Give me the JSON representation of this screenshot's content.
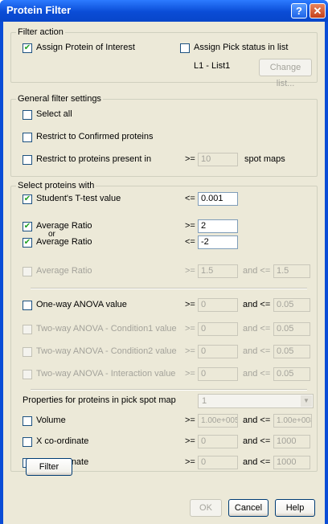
{
  "window": {
    "title": "Protein Filter",
    "help_glyph": "?",
    "close_glyph": "✕"
  },
  "check_glyph": "✔",
  "filter_action": {
    "legend": "Filter action",
    "assign_protein": {
      "label": "Assign Protein of Interest",
      "checked": true
    },
    "assign_pick": {
      "label": "Assign Pick status in list",
      "checked": false
    },
    "list_name": "L1 - List1",
    "change_list": "Change list..."
  },
  "general": {
    "legend": "General filter settings",
    "select_all": {
      "label": "Select all",
      "checked": false
    },
    "confirmed": {
      "label": "Restrict to Confirmed proteins",
      "checked": false
    },
    "present_in": {
      "label": "Restrict to proteins present in",
      "checked": false,
      "op": ">=",
      "value": "10",
      "unit": "spot maps"
    }
  },
  "select": {
    "legend": "Select proteins with",
    "ttest": {
      "label": "Student's T-test value",
      "checked": true,
      "op": "<=",
      "value": "0.001"
    },
    "ratio1": {
      "label": "Average Ratio",
      "checked": true,
      "op": ">=",
      "value": "2"
    },
    "or_label": "or",
    "ratio2": {
      "label": "Average Ratio",
      "checked": true,
      "op": "<=",
      "value": "-2"
    },
    "ratio3": {
      "label": "Average Ratio",
      "checked": false,
      "op": ">=",
      "value": "1.5",
      "and_op": "and <=",
      "value2": "1.5"
    },
    "anova": {
      "label": "One-way ANOVA value",
      "checked": false,
      "op": ">=",
      "value": "0",
      "and_op": "and <=",
      "value2": "0.05"
    },
    "anova_c1": {
      "label": "Two-way ANOVA - Condition1 value",
      "op": ">=",
      "value": "0",
      "and_op": "and <=",
      "value2": "0.05"
    },
    "anova_c2": {
      "label": "Two-way ANOVA - Condition2 value",
      "op": ">=",
      "value": "0",
      "and_op": "and <=",
      "value2": "0.05"
    },
    "anova_int": {
      "label": "Two-way ANOVA - Interaction value",
      "op": ">=",
      "value": "0",
      "and_op": "and <=",
      "value2": "0.05"
    },
    "props_label": "Properties for proteins in pick spot map",
    "props_select": "1",
    "volume": {
      "label": "Volume",
      "checked": false,
      "op": ">=",
      "value": "1.00e+005",
      "and_op": "and <=",
      "value2": "1.00e+008"
    },
    "xcoord": {
      "label": "X co-ordinate",
      "checked": false,
      "op": ">=",
      "value": "0",
      "and_op": "and <=",
      "value2": "1000"
    },
    "ycoord": {
      "label": "Y co-ordinate",
      "checked": false,
      "op": ">=",
      "value": "0",
      "and_op": "and <=",
      "value2": "1000"
    }
  },
  "buttons": {
    "filter": "Filter",
    "ok": "OK",
    "cancel": "Cancel",
    "help": "Help"
  }
}
